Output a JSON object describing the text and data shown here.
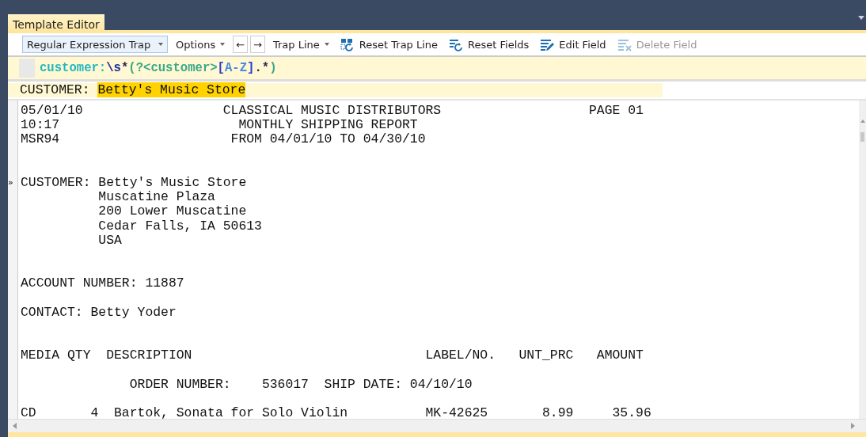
{
  "tabs": [
    {
      "label": "Template Editor",
      "selected": true
    }
  ],
  "toolbar": [
    {
      "kind": "combo",
      "label": "Regular Expression Trap",
      "disabled": false
    },
    {
      "kind": "menu",
      "label": "Options",
      "disabled": false
    },
    {
      "kind": "arrow",
      "label": "←",
      "disabled": false
    },
    {
      "kind": "arrow",
      "label": "→",
      "disabled": false
    },
    {
      "kind": "menu",
      "label": "Trap Line",
      "disabled": false
    },
    {
      "kind": "reset-trap",
      "label": "Reset Trap Line",
      "disabled": false
    },
    {
      "kind": "reset-fields",
      "label": "Reset Fields",
      "disabled": false
    },
    {
      "kind": "edit",
      "label": "Edit Field",
      "disabled": false
    },
    {
      "kind": "delete",
      "label": "Delete Field",
      "disabled": true
    }
  ],
  "regex": [
    {
      "kind": "literal",
      "text": "customer:"
    },
    {
      "kind": "escape",
      "text": "\\s"
    },
    {
      "kind": "operator",
      "text": "*"
    },
    {
      "kind": "group",
      "text": "(?<customer>"
    },
    {
      "kind": "bracket",
      "text": "["
    },
    {
      "kind": "range",
      "text": "A-Z"
    },
    {
      "kind": "bracket",
      "text": "]"
    },
    {
      "kind": "operator",
      "text": ".*"
    },
    {
      "kind": "group",
      "text": ")"
    }
  ],
  "match": {
    "label": "CUSTOMER: ",
    "value": "Betty's Music Store"
  },
  "document": [
    {
      "kind": "text",
      "text": "05/01/10                  CLASSICAL MUSIC DISTRIBUTORS                   PAGE 01"
    },
    {
      "kind": "text",
      "text": "10:17                       MONTHLY SHIPPING REPORT"
    },
    {
      "kind": "text",
      "text": "MSR94                      FROM 04/01/10 TO 04/30/10"
    },
    {
      "kind": "blank"
    },
    {
      "kind": "blank"
    },
    {
      "kind": "text",
      "text": "CUSTOMER: Betty's Music Store",
      "marker": "»"
    },
    {
      "kind": "text",
      "text": "          Muscatine Plaza"
    },
    {
      "kind": "text",
      "text": "          200 Lower Muscatine"
    },
    {
      "kind": "text",
      "text": "          Cedar Falls, IA 50613"
    },
    {
      "kind": "text",
      "text": "          USA"
    },
    {
      "kind": "blank"
    },
    {
      "kind": "blank"
    },
    {
      "kind": "text",
      "text": "ACCOUNT NUMBER: 11887"
    },
    {
      "kind": "blank"
    },
    {
      "kind": "text",
      "text": "CONTACT: Betty Yoder"
    },
    {
      "kind": "blank"
    },
    {
      "kind": "blank"
    },
    {
      "kind": "text",
      "text": "MEDIA QTY  DESCRIPTION                              LABEL/NO.   UNT_PRC   AMOUNT"
    },
    {
      "kind": "blank"
    },
    {
      "kind": "text",
      "text": "              ORDER NUMBER:    536017  SHIP DATE: 04/10/10"
    },
    {
      "kind": "blank"
    },
    {
      "kind": "text",
      "text": "CD       4  Bartok, Sonata for Solo Violin          MK-42625       8.99     35.96"
    }
  ]
}
